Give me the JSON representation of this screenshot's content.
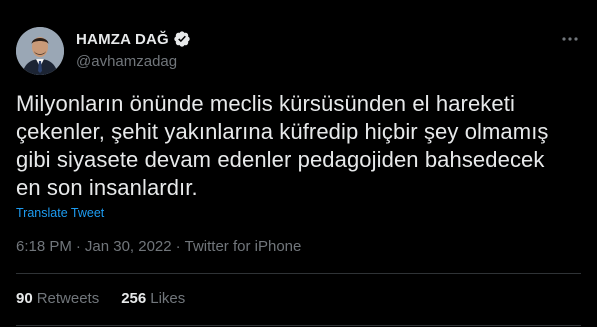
{
  "author": {
    "display_name": "HAMZA DAĞ",
    "handle": "@avhamzadag",
    "avatar_icon": "profile-photo",
    "verified_icon": "verified-badge-icon"
  },
  "tweet": {
    "text": "Milyonların önünde meclis kürsüsünden el hareketi\nçekenler, şehit yakınlarına küfredip hiçbir şey olmamış\ngibi siyasete devam edenler pedagojiden bahsedecek\nen son insanlardır.",
    "translate_label": "Translate Tweet"
  },
  "meta": {
    "time": "6:18 PM",
    "separator1": "·",
    "date": "Jan 30, 2022",
    "separator2": "·",
    "source": "Twitter for iPhone"
  },
  "stats": {
    "retweets_count": "90",
    "retweets_label": "Retweets",
    "likes_count": "256",
    "likes_label": "Likes"
  },
  "colors": {
    "background": "#000000",
    "text": "#e7e9ea",
    "muted": "#71767b",
    "link": "#1d9bf0",
    "divider": "#2f3336"
  }
}
